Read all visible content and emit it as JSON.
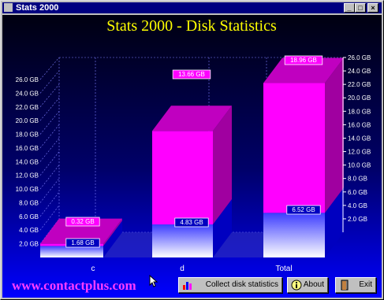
{
  "window": {
    "title": "Stats 2000"
  },
  "chart_data": {
    "type": "bar",
    "title": "Stats 2000 - Disk Statistics",
    "categories": [
      "c",
      "d",
      "Total"
    ],
    "series": [
      {
        "values": [
          1.68,
          4.83,
          6.52
        ],
        "colors": [
          "#3c3cff",
          "#ffffff"
        ]
      },
      {
        "values": [
          0.32,
          13.66,
          18.96
        ],
        "color": "#ff00ff"
      }
    ],
    "left_ticks": [
      "2.0 GB",
      "4.0 GB",
      "6.0 GB",
      "8.0 GB",
      "10.0 GB",
      "12.0 GB",
      "14.0 GB",
      "16.0 GB",
      "18.0 GB",
      "20.0 GB",
      "22.0 GB",
      "24.0 GB",
      "26.0 GB"
    ],
    "right_ticks": [
      "2.0 GB",
      "4.0 GB",
      "6.0 GB",
      "8.0 GB",
      "10.0 GB",
      "12.0 GB",
      "14.0 GB",
      "16.0 GB",
      "18.0 GB",
      "20.0 GB",
      "22.0 GB",
      "24.0 GB",
      "26.0 GB"
    ],
    "labels": {
      "c_used": "1.68 GB",
      "c_free": "0.32 GB",
      "d_used": "4.83 GB",
      "d_free": "13.66 GB",
      "t_used": "6.52 GB",
      "t_free": "18.96 GB"
    },
    "ylim": [
      0,
      26
    ]
  },
  "footer": {
    "url": "www.contactplus.com",
    "collect_label": "Collect disk statistics",
    "about_label": "About",
    "exit_label": "Exit"
  }
}
